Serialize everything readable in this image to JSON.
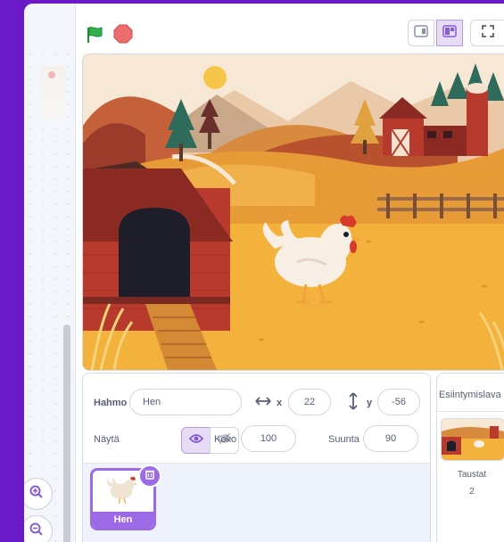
{
  "code_area": {
    "zoom_in_icon": "zoom-in-icon",
    "zoom_out_icon": "zoom-out-icon"
  },
  "stage_header": {
    "green_flag_icon": "green-flag-icon",
    "stop_icon": "stop-icon",
    "small_stage_icon": "small-stage-icon",
    "large_stage_icon": "large-stage-icon",
    "fullscreen_icon": "fullscreen-icon"
  },
  "sprite_info": {
    "sprite_label": "Hahmo",
    "sprite_name": "Hen",
    "x_label": "x",
    "x_value": "22",
    "y_label": "y",
    "y_value": "-56",
    "show_label": "Näytä",
    "size_label": "Koko",
    "size_value": "100",
    "direction_label": "Suunta",
    "direction_value": "90"
  },
  "sprites": [
    {
      "name": "Hen",
      "selected": true
    }
  ],
  "backdrop_panel": {
    "title": "Esiintymislava",
    "backdrops_label": "Taustat",
    "backdrops_count": "2"
  },
  "colors": {
    "accent": "#9d6ae6",
    "outer_background": "#6a19c7",
    "flag": "#2fb24c",
    "stop": "#ec6d6d"
  }
}
